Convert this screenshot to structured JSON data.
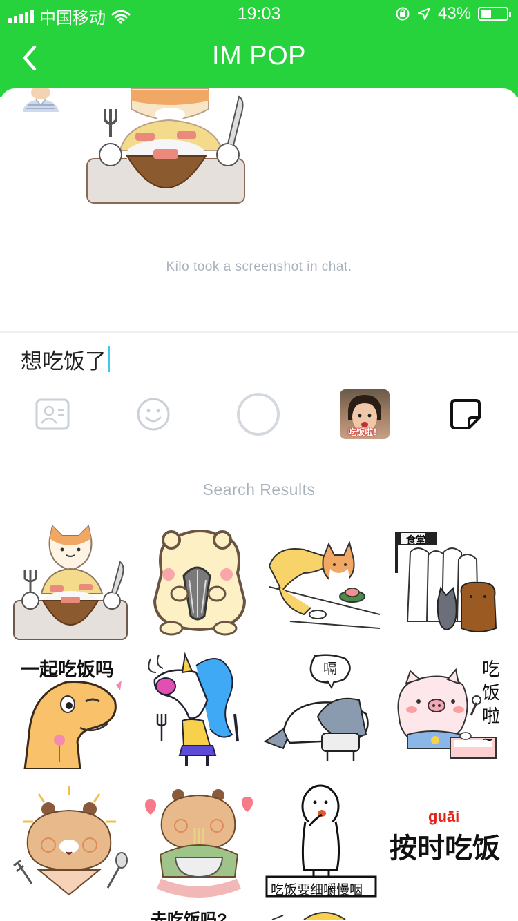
{
  "status_bar": {
    "carrier": "中国移动",
    "time": "19:03",
    "battery_percent": "43%",
    "battery_level": 0.43
  },
  "nav": {
    "title": "IM POP",
    "back_icon": "chevron-left-icon"
  },
  "chat": {
    "system_message": "Kilo took a screenshot in chat."
  },
  "input": {
    "value": "想吃饭了"
  },
  "toolbar": {
    "items": [
      {
        "icon": "contact-card-icon"
      },
      {
        "icon": "emoji-icon"
      },
      {
        "icon": "circle-icon"
      },
      {
        "icon": "photo-thumbnail",
        "caption": "吃饭啦！"
      },
      {
        "icon": "sticker-icon"
      }
    ]
  },
  "results": {
    "label": "Search Results",
    "stickers": [
      {
        "name": "cat-eating-rice"
      },
      {
        "name": "hamster-sunflower-seed"
      },
      {
        "name": "cat-crawling-to-sushi"
      },
      {
        "name": "canteen-cats",
        "text": "食堂"
      },
      {
        "name": "dinosaur-eat-together",
        "text": "一起吃饭吗"
      },
      {
        "name": "unicorn-fork-knife"
      },
      {
        "name": "salted-fish",
        "text": "嗝"
      },
      {
        "name": "pig-eating",
        "text": "吃饭啦~"
      },
      {
        "name": "bear-fork-spoon"
      },
      {
        "name": "bear-eating-noodles"
      },
      {
        "name": "chew-slowly",
        "text": "吃饭要细嚼慢咽"
      },
      {
        "name": "eat-on-time",
        "pinyin": "guāi",
        "text": "按时吃饭"
      },
      {
        "name": "partial-row-1"
      },
      {
        "name": "partial-row-2",
        "text": "去吃饭吗?"
      },
      {
        "name": "partial-row-3"
      },
      {
        "name": "partial-row-4"
      }
    ]
  },
  "colors": {
    "header_green": "#27d33c",
    "grey_text": "#a9b2bc",
    "caret": "#3fc7f0"
  }
}
